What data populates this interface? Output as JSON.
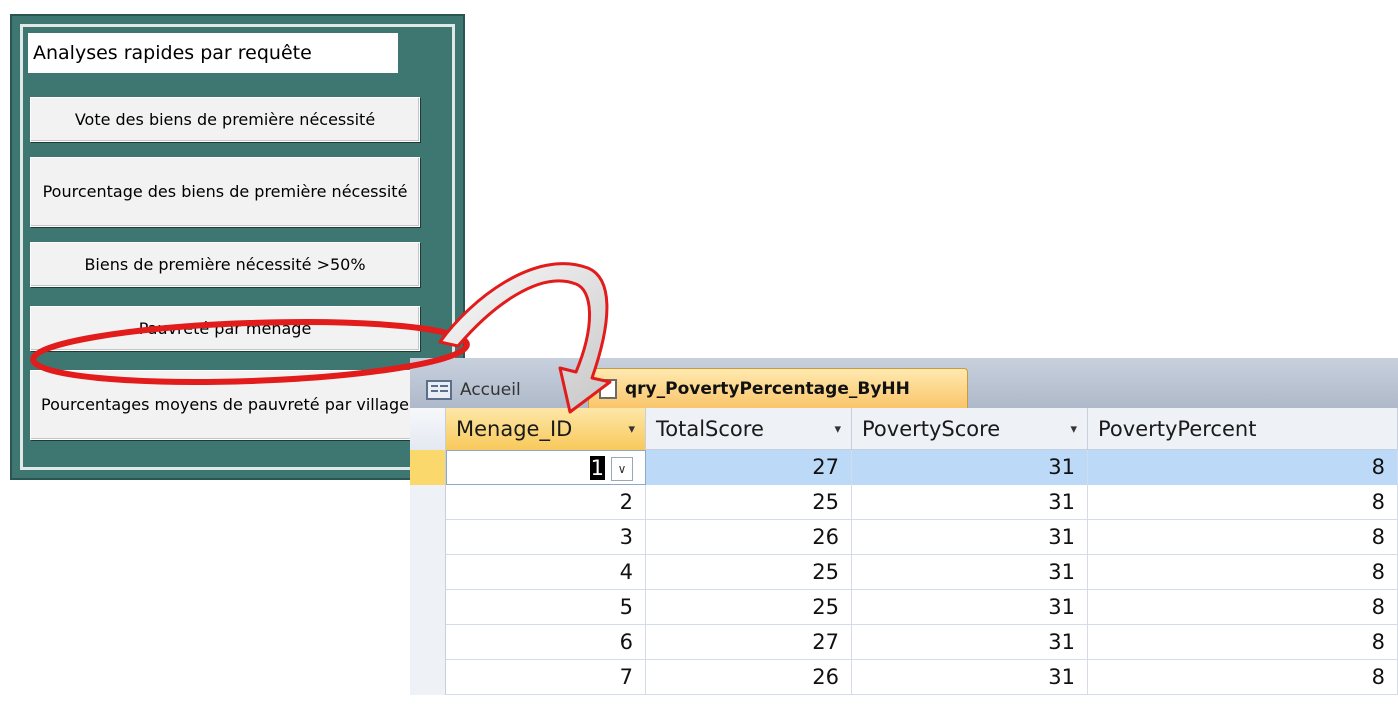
{
  "form_panel": {
    "title": "Analyses rapides par requête",
    "buttons": [
      "Vote des biens de première nécessité",
      "Pourcentage des biens de première nécessité",
      "Biens de première nécessité >50%",
      "Pauvreté par ménage",
      "Pourcentages moyens de pauvreté par village"
    ]
  },
  "datasheet": {
    "tabs": {
      "home": "Accueil",
      "query": "qry_PovertyPercentage_ByHH"
    },
    "columns": [
      "Menage_ID",
      "TotalScore",
      "PovertyScore",
      "PovertyPercent"
    ],
    "rows": [
      [
        "1",
        "27",
        "31",
        "8"
      ],
      [
        "2",
        "25",
        "31",
        "8"
      ],
      [
        "3",
        "26",
        "31",
        "8"
      ],
      [
        "4",
        "25",
        "31",
        "8"
      ],
      [
        "5",
        "25",
        "31",
        "8"
      ],
      [
        "6",
        "27",
        "31",
        "8"
      ],
      [
        "7",
        "26",
        "31",
        "8"
      ]
    ],
    "selected_row": 0,
    "combo_arrow": "∨",
    "column_dropdown": "▾"
  },
  "colors": {
    "panel_bg": "#3e7672",
    "highlight_red": "#e21b1b",
    "tab_active": "#f9c56a",
    "row_selected": "#bcd9f7"
  }
}
